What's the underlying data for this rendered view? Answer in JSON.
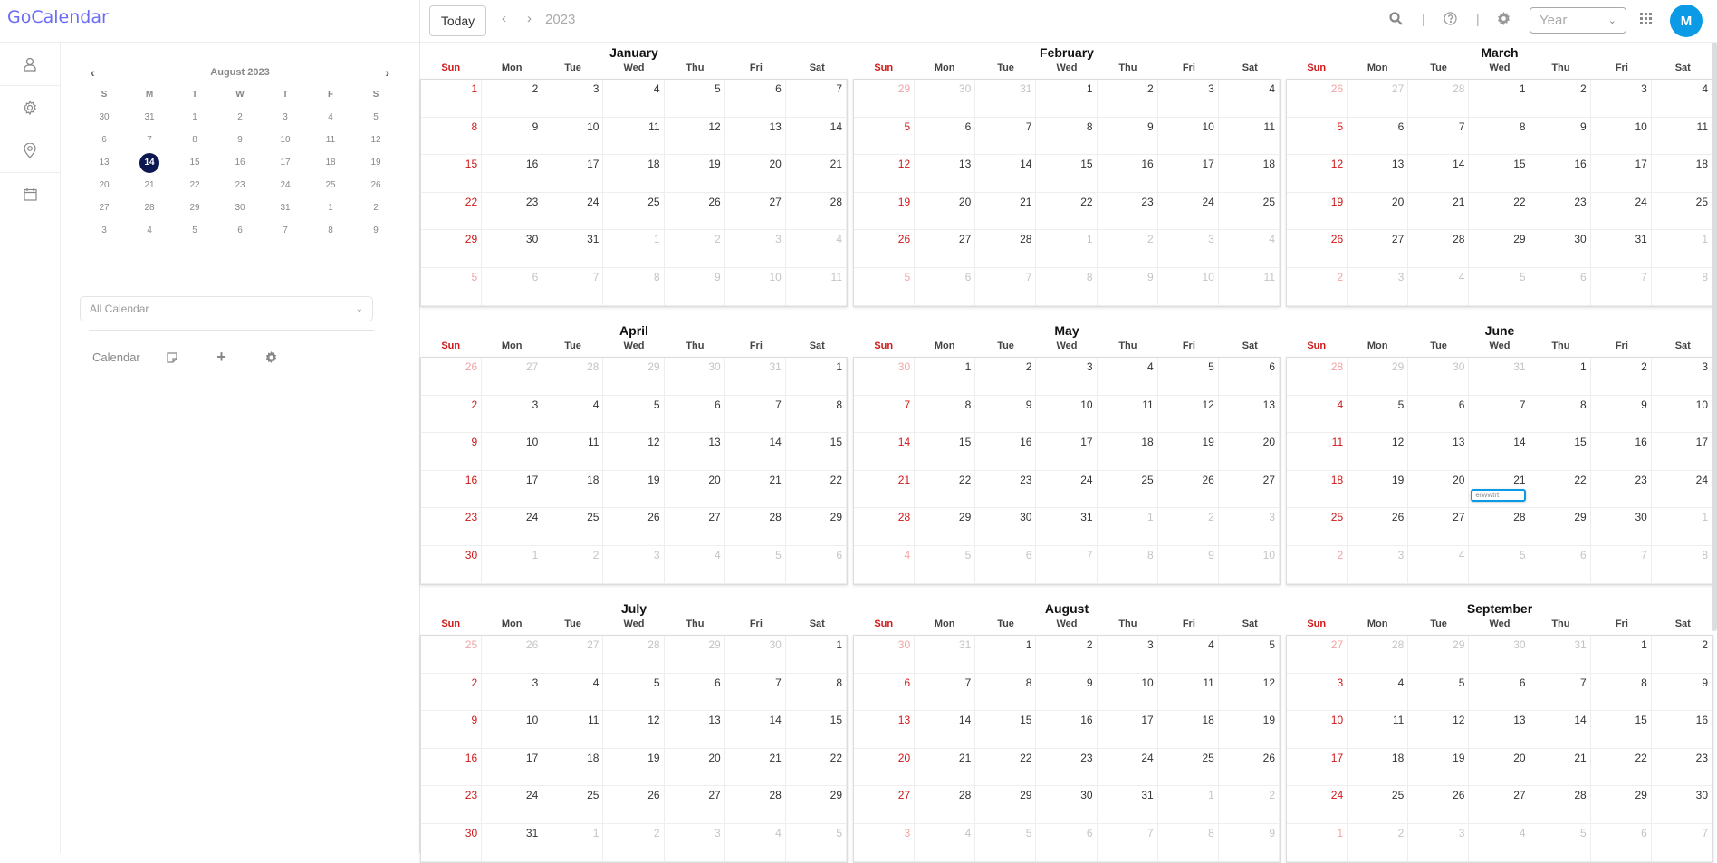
{
  "app": {
    "title": "GoCalendar"
  },
  "rail": [
    {
      "icon": "user-icon"
    },
    {
      "icon": "gear-icon"
    },
    {
      "icon": "location-pin-icon"
    },
    {
      "icon": "calendar-icon"
    }
  ],
  "mini_calendar": {
    "title": "August 2023",
    "weekdays": [
      "S",
      "M",
      "T",
      "W",
      "T",
      "F",
      "S"
    ],
    "days": [
      30,
      31,
      1,
      2,
      3,
      4,
      5,
      6,
      7,
      8,
      9,
      10,
      11,
      12,
      13,
      14,
      15,
      16,
      17,
      18,
      19,
      20,
      21,
      22,
      23,
      24,
      25,
      26,
      27,
      28,
      29,
      30,
      31,
      1,
      2,
      3,
      4,
      5,
      6,
      7,
      8,
      9
    ],
    "today": "14"
  },
  "calendar_select": {
    "value": "All Calendar"
  },
  "calendar_tools": {
    "label": "Calendar"
  },
  "toolbar": {
    "today_label": "Today",
    "year": "2023",
    "separator": "|",
    "view": "Year",
    "avatar": "M"
  },
  "weekdays": [
    "Sun",
    "Mon",
    "Tue",
    "Wed",
    "Thu",
    "Fri",
    "Sat"
  ],
  "months": [
    {
      "name": "January",
      "lead": 0,
      "count": 31,
      "days": [
        1,
        2,
        3,
        4,
        5,
        6,
        7,
        8,
        9,
        10,
        11,
        12,
        13,
        14,
        15,
        16,
        17,
        18,
        19,
        20,
        21,
        22,
        23,
        24,
        25,
        26,
        27,
        28,
        29,
        30,
        31,
        1,
        2,
        3,
        4,
        5,
        6,
        7,
        8,
        9,
        10,
        11
      ]
    },
    {
      "name": "February",
      "lead": 3,
      "count": 28,
      "days": [
        29,
        30,
        31,
        1,
        2,
        3,
        4,
        5,
        6,
        7,
        8,
        9,
        10,
        11,
        12,
        13,
        14,
        15,
        16,
        17,
        18,
        19,
        20,
        21,
        22,
        23,
        24,
        25,
        26,
        27,
        28,
        1,
        2,
        3,
        4,
        5,
        6,
        7,
        8,
        9,
        10,
        11
      ]
    },
    {
      "name": "March",
      "lead": 3,
      "count": 31,
      "days": [
        26,
        27,
        28,
        1,
        2,
        3,
        4,
        5,
        6,
        7,
        8,
        9,
        10,
        11,
        12,
        13,
        14,
        15,
        16,
        17,
        18,
        19,
        20,
        21,
        22,
        23,
        24,
        25,
        26,
        27,
        28,
        29,
        30,
        31,
        1,
        2,
        3,
        4,
        5,
        6,
        7,
        8
      ]
    },
    {
      "name": "April",
      "lead": 6,
      "count": 30,
      "days": [
        26,
        27,
        28,
        29,
        30,
        31,
        1,
        2,
        3,
        4,
        5,
        6,
        7,
        8,
        9,
        10,
        11,
        12,
        13,
        14,
        15,
        16,
        17,
        18,
        19,
        20,
        21,
        22,
        23,
        24,
        25,
        26,
        27,
        28,
        29,
        30,
        1,
        2,
        3,
        4,
        5,
        6
      ]
    },
    {
      "name": "May",
      "lead": 1,
      "count": 31,
      "days": [
        30,
        1,
        2,
        3,
        4,
        5,
        6,
        7,
        8,
        9,
        10,
        11,
        12,
        13,
        14,
        15,
        16,
        17,
        18,
        19,
        20,
        21,
        22,
        23,
        24,
        25,
        26,
        27,
        28,
        29,
        30,
        31,
        1,
        2,
        3,
        4,
        5,
        6,
        7,
        8,
        9,
        10
      ]
    },
    {
      "name": "June",
      "lead": 4,
      "count": 30,
      "days": [
        28,
        29,
        30,
        31,
        1,
        2,
        3,
        4,
        5,
        6,
        7,
        8,
        9,
        10,
        11,
        12,
        13,
        14,
        15,
        16,
        17,
        18,
        19,
        20,
        21,
        22,
        23,
        24,
        25,
        26,
        27,
        28,
        29,
        30,
        1,
        2,
        3,
        4,
        5,
        6,
        7,
        8
      ],
      "events": [
        {
          "day": 21,
          "title": "erwwtrt"
        }
      ]
    },
    {
      "name": "July",
      "lead": 6,
      "count": 31,
      "days": [
        25,
        26,
        27,
        28,
        29,
        30,
        1,
        2,
        3,
        4,
        5,
        6,
        7,
        8,
        9,
        10,
        11,
        12,
        13,
        14,
        15,
        16,
        17,
        18,
        19,
        20,
        21,
        22,
        23,
        24,
        25,
        26,
        27,
        28,
        29,
        30,
        31,
        1,
        2,
        3,
        4,
        5
      ]
    },
    {
      "name": "August",
      "lead": 2,
      "count": 31,
      "days": [
        30,
        31,
        1,
        2,
        3,
        4,
        5,
        6,
        7,
        8,
        9,
        10,
        11,
        12,
        13,
        14,
        15,
        16,
        17,
        18,
        19,
        20,
        21,
        22,
        23,
        24,
        25,
        26,
        27,
        28,
        29,
        30,
        31,
        1,
        2,
        3,
        4,
        5,
        6,
        7,
        8,
        9
      ]
    },
    {
      "name": "September",
      "lead": 5,
      "count": 30,
      "days": [
        27,
        28,
        29,
        30,
        31,
        1,
        2,
        3,
        4,
        5,
        6,
        7,
        8,
        9,
        10,
        11,
        12,
        13,
        14,
        15,
        16,
        17,
        18,
        19,
        20,
        21,
        22,
        23,
        24,
        25,
        26,
        27,
        28,
        29,
        30,
        1,
        2,
        3,
        4,
        5,
        6,
        7
      ]
    }
  ],
  "colors": {
    "brand": "#6a6cf5",
    "sunday": "#d01818",
    "today_bg": "#0d1850",
    "accent": "#0a9ae6"
  }
}
